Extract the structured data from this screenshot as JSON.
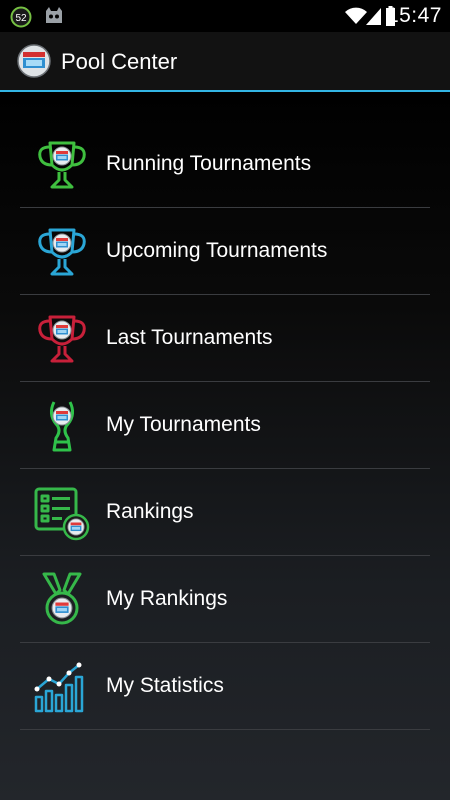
{
  "status_bar": {
    "notification_badge": "52",
    "time": "15:47",
    "icons": [
      "cyanogen-icon",
      "wifi-icon",
      "signal-icon",
      "battery-icon"
    ]
  },
  "action_bar": {
    "title": "Pool Center",
    "accent_color": "#33b5e5",
    "icon": "pool-app-icon"
  },
  "menu": {
    "items": [
      {
        "label": "Running Tournaments",
        "icon": "trophy-icon",
        "color": "#3fbf3f"
      },
      {
        "label": "Upcoming Tournaments",
        "icon": "trophy-icon",
        "color": "#2aa6d6"
      },
      {
        "label": "Last Tournaments",
        "icon": "trophy-icon",
        "color": "#c8203a"
      },
      {
        "label": "My Tournaments",
        "icon": "world-cup-trophy-icon",
        "color": "#2fc24a"
      },
      {
        "label": "Rankings",
        "icon": "ranking-board-icon",
        "color": "#36b84a"
      },
      {
        "label": "My Rankings",
        "icon": "medal-icon",
        "color": "#36b84a"
      },
      {
        "label": "My Statistics",
        "icon": "statistics-chart-icon",
        "color": "#2aa6d6"
      }
    ]
  }
}
